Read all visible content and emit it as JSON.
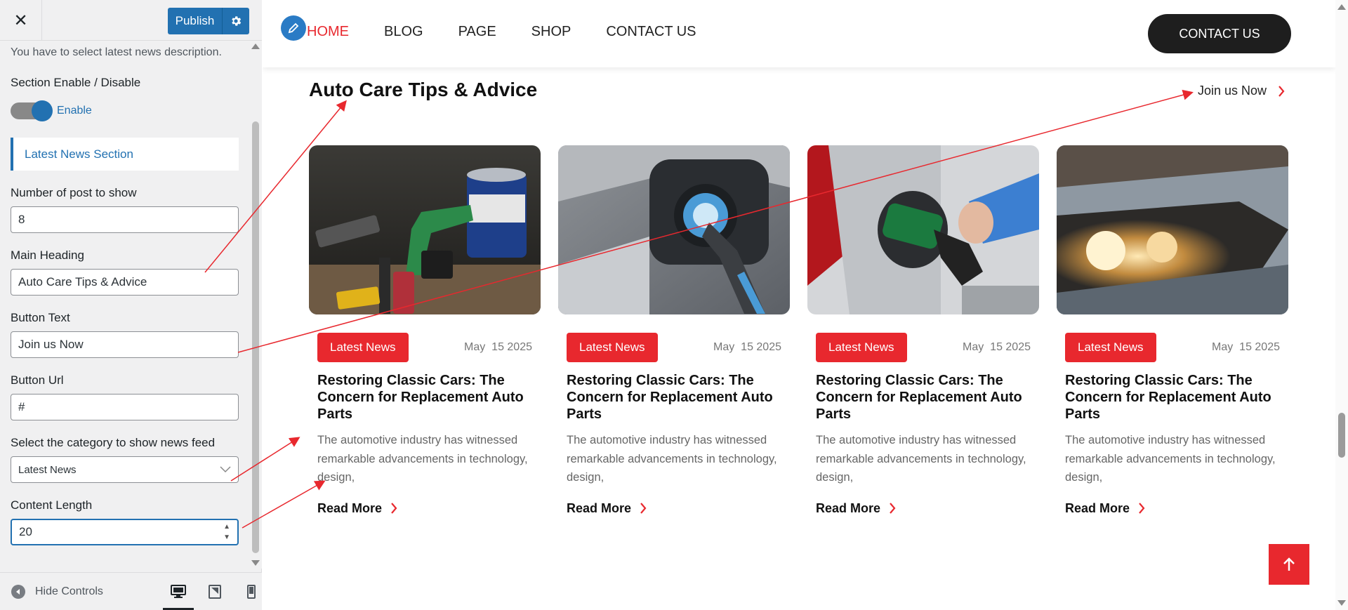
{
  "customizer": {
    "close_label": "✕",
    "publish_label": "Publish",
    "description": "You have to select latest news description.",
    "section_toggle_title": "Section Enable / Disable",
    "toggle_label": "Enable",
    "section_heading": "Latest News Section",
    "fields": {
      "posts_label": "Number of post to show",
      "posts_value": "8",
      "heading_label": "Main Heading",
      "heading_value": "Auto Care Tips & Advice",
      "button_text_label": "Button Text",
      "button_text_value": "Join us Now",
      "button_url_label": "Button Url",
      "button_url_value": "#",
      "category_label": "Select the category to show news feed",
      "category_value": "Latest News",
      "content_length_label": "Content Length",
      "content_length_value": "20"
    },
    "hide_controls_label": "Hide Controls",
    "devices": [
      "desktop-icon",
      "tablet-icon",
      "mobile-icon"
    ]
  },
  "site": {
    "menu": [
      "HOME",
      "BLOG",
      "PAGE",
      "SHOP",
      "CONTACT US"
    ],
    "active_menu": "HOME",
    "cta_label": "CONTACT US",
    "section_heading": "Auto Care Tips & Advice",
    "join_label": "Join us Now",
    "cards": [
      {
        "badge": "Latest News",
        "date": "May  15 2025",
        "title": "Restoring Classic Cars: The Concern for Replacement Auto Parts",
        "excerpt": "The automotive industry has witnessed remarkable advancements in technology, design,",
        "read_more": "Read More"
      },
      {
        "badge": "Latest News",
        "date": "May  15 2025",
        "title": "Restoring Classic Cars: The Concern for Replacement Auto Parts",
        "excerpt": "The automotive industry has witnessed remarkable advancements in technology, design,",
        "read_more": "Read More"
      },
      {
        "badge": "Latest News",
        "date": "May  15 2025",
        "title": "Restoring Classic Cars: The Concern for Replacement Auto Parts",
        "excerpt": "The automotive industry has witnessed remarkable advancements in technology, design,",
        "read_more": "Read More"
      },
      {
        "badge": "Latest News",
        "date": "May  15 2025",
        "title": "Restoring Classic Cars: The Concern for Replacement Auto Parts",
        "excerpt": "The automotive industry has witnessed remarkable advancements in technology, design,",
        "read_more": "Read More"
      }
    ]
  },
  "colors": {
    "accent_red": "#e8282e",
    "wp_blue": "#2271b1",
    "dark": "#1e1e1e",
    "annotation_arrow": "#e8282e"
  }
}
